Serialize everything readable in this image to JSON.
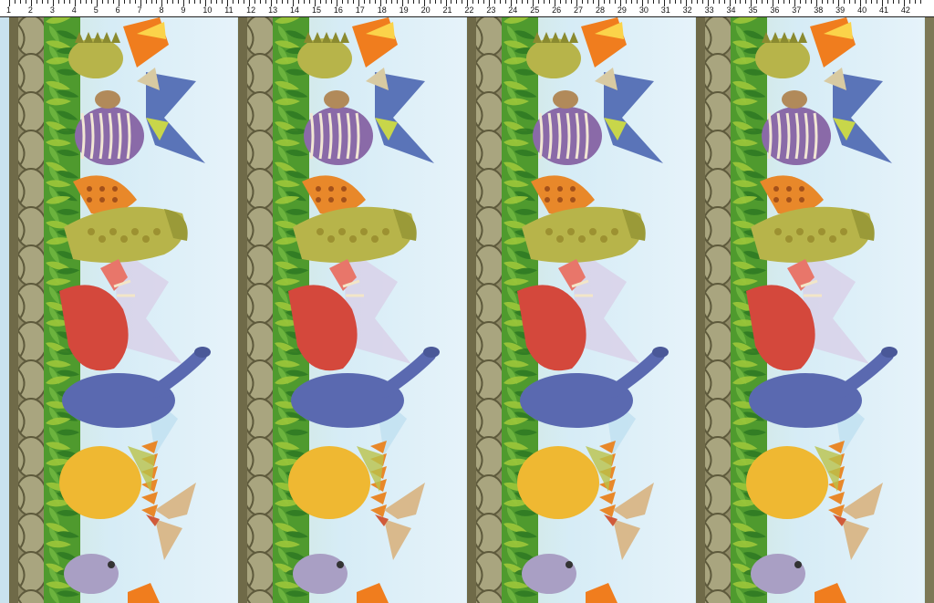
{
  "ruler": {
    "labels": [
      "1",
      "2",
      "3",
      "4",
      "5",
      "6",
      "7",
      "8",
      "9",
      "10",
      "11",
      "12",
      "13",
      "14",
      "15",
      "16",
      "17",
      "18",
      "19",
      "20",
      "21",
      "22",
      "23",
      "24",
      "25",
      "26",
      "27",
      "28",
      "29",
      "30",
      "31",
      "32",
      "33",
      "34",
      "35",
      "36",
      "37",
      "38",
      "39",
      "40",
      "41",
      "42"
    ]
  },
  "artwork": {
    "panel_repeats": 4,
    "motifs": [
      "volcano-icon",
      "stegosaurus-icon",
      "pterosaur-icon",
      "striped-dinosaur-icon",
      "spotted-dinosaur-icon",
      "tyrannosaurus-icon",
      "triceratops-icon",
      "sauropod-icon",
      "plated-stegosaurus-icon",
      "flying-pteranodon-icon",
      "baby-dinosaur-icon",
      "rock-wall-icon",
      "palm-foliage-icon"
    ],
    "colors": {
      "sky": "#d6ecf6",
      "rock": "#8f8a66",
      "rock_dark": "#5e5a3c",
      "foliage": "#4f9a2e",
      "foliage_light": "#9cc63a",
      "purple": "#8a6aa8",
      "blue_dino": "#5a69b0",
      "orange": "#e8882a",
      "yellow_green": "#b7b44a",
      "red": "#d4483c",
      "yellow": "#efb832",
      "tan": "#d9b98c",
      "lilac": "#a99fc4",
      "volcano": "#f07d1e"
    }
  }
}
